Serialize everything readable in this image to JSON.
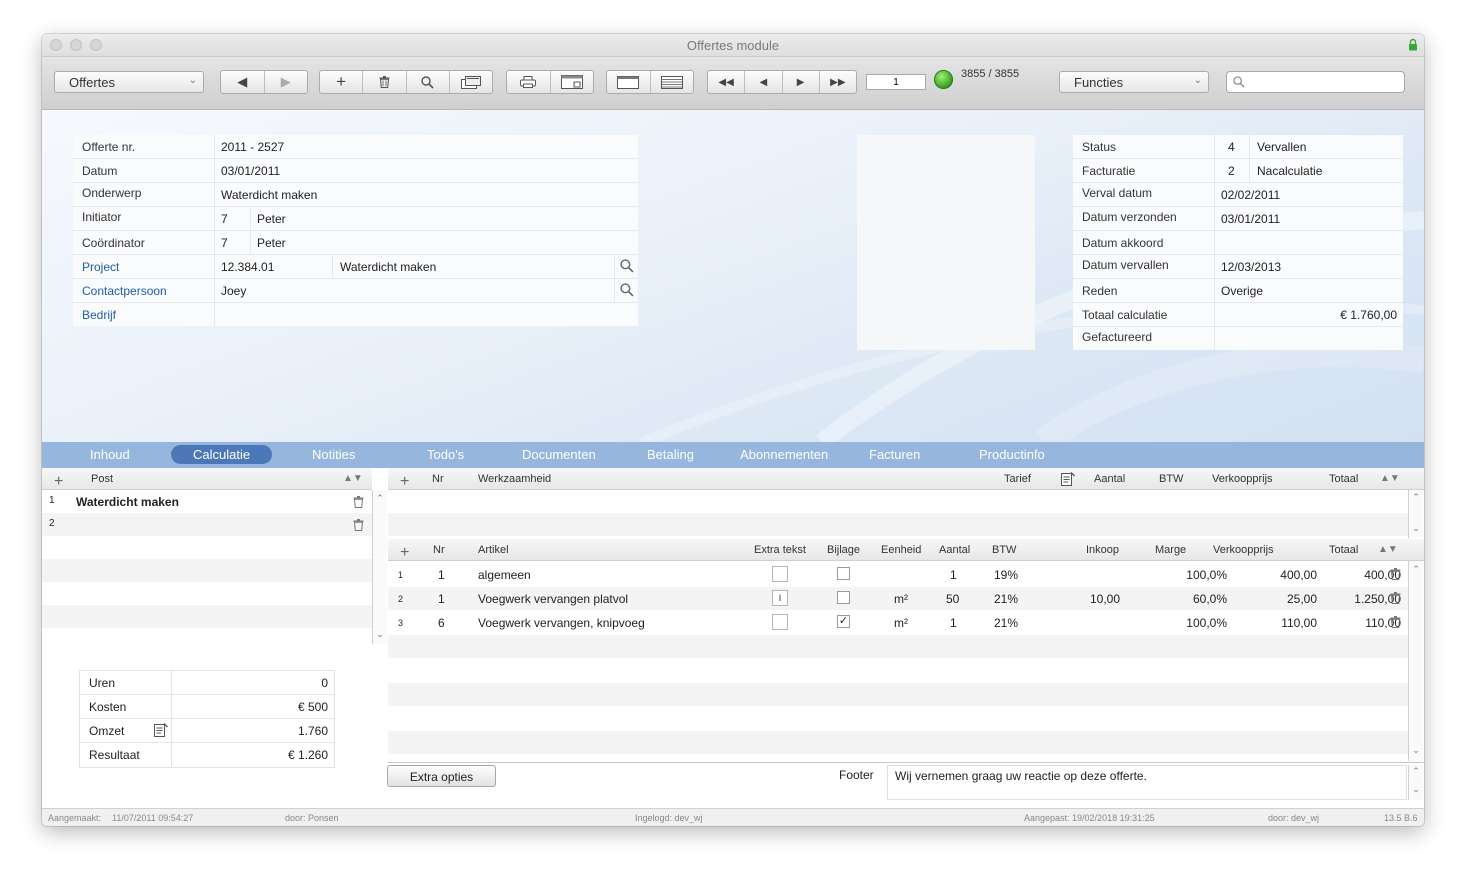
{
  "window": {
    "title": "Offertes module"
  },
  "toolbar": {
    "module_select": "Offertes",
    "record_input": "1",
    "record_count": "3855 / 3855",
    "functions_select": "Functies",
    "search_placeholder": ""
  },
  "form": {
    "offerte_nr": {
      "label": "Offerte nr.",
      "value": "2011 - 2527"
    },
    "datum": {
      "label": "Datum",
      "value": "03/01/2011"
    },
    "onderwerp": {
      "label": "Onderwerp",
      "value": "Waterdicht maken"
    },
    "initiator": {
      "label": "Initiator",
      "id": "7",
      "name": "Peter"
    },
    "coordinator": {
      "label": "Coördinator",
      "id": "7",
      "name": "Peter"
    },
    "project": {
      "label": "Project",
      "code": "12.384.01",
      "name": "Waterdicht maken"
    },
    "contactpersoon": {
      "label": "Contactpersoon",
      "value": "Joey"
    },
    "bedrijf": {
      "label": "Bedrijf",
      "value": ""
    }
  },
  "status_panel": {
    "status": {
      "label": "Status",
      "id": "4",
      "value": "Vervallen"
    },
    "facturatie": {
      "label": "Facturatie",
      "id": "2",
      "value": "Nacalculatie"
    },
    "verval_datum": {
      "label": "Verval datum",
      "value": "02/02/2011"
    },
    "datum_verzonden": {
      "label": "Datum verzonden",
      "value": "03/01/2011"
    },
    "datum_akkoord": {
      "label": "Datum akkoord",
      "value": ""
    },
    "datum_vervallen": {
      "label": "Datum vervallen",
      "value": "12/03/2013"
    },
    "reden": {
      "label": "Reden",
      "value": "Overige"
    },
    "totaal_calculatie": {
      "label": "Totaal calculatie",
      "value": "€ 1.760,00"
    },
    "gefactureerd": {
      "label": "Gefactureerd",
      "value": ""
    }
  },
  "tabs": [
    "Inhoud",
    "Calculatie",
    "Notities",
    "Todo's",
    "Documenten",
    "Betaling",
    "Abonnementen",
    "Facturen",
    "Productinfo"
  ],
  "posts": {
    "header": "Post",
    "rows": [
      {
        "nr": "1",
        "name": "Waterdicht maken"
      },
      {
        "nr": "2",
        "name": ""
      }
    ]
  },
  "werk": {
    "headers": {
      "nr": "Nr",
      "werkzaamheid": "Werkzaamheid",
      "tarief": "Tarief",
      "aantal": "Aantal",
      "btw": "BTW",
      "verkoopprijs": "Verkoopprijs",
      "totaal": "Totaal"
    }
  },
  "artikelen": {
    "headers": {
      "nr": "Nr",
      "artikel": "Artikel",
      "extra_tekst": "Extra tekst",
      "bijlage": "Bijlage",
      "eenheid": "Eenheid",
      "aantal": "Aantal",
      "btw": "BTW",
      "inkoop": "Inkoop",
      "marge": "Marge",
      "verkoopprijs": "Verkoopprijs",
      "totaal": "Totaal"
    },
    "rows": [
      {
        "idx": "1",
        "nr": "1",
        "artikel": "algemeen",
        "extra_tekst": "",
        "bijlage": "",
        "eenheid": "",
        "aantal": "1",
        "btw": "19%",
        "inkoop": "",
        "marge": "100,0%",
        "verkoopprijs": "400,00",
        "totaal": "400,00"
      },
      {
        "idx": "2",
        "nr": "1",
        "artikel": "Voegwerk vervangen platvol",
        "extra_tekst": "I",
        "bijlage": "",
        "eenheid": "m²",
        "aantal": "50",
        "btw": "21%",
        "inkoop": "10,00",
        "marge": "60,0%",
        "verkoopprijs": "25,00",
        "totaal": "1.250,00"
      },
      {
        "idx": "3",
        "nr": "6",
        "artikel": "Voegwerk vervangen, knipvoeg",
        "extra_tekst": "",
        "bijlage": "✓",
        "eenheid": "m²",
        "aantal": "1",
        "btw": "21%",
        "inkoop": "",
        "marge": "100,0%",
        "verkoopprijs": "110,00",
        "totaal": "110,00"
      }
    ]
  },
  "summary": {
    "uren": {
      "label": "Uren",
      "value": "0"
    },
    "kosten": {
      "label": "Kosten",
      "value": "€ 500"
    },
    "omzet": {
      "label": "Omzet",
      "value": "1.760"
    },
    "resultaat": {
      "label": "Resultaat",
      "value": "€ 1.260"
    }
  },
  "extra_opties_label": "Extra opties",
  "footer": {
    "label": "Footer",
    "value": "Wij vernemen graag uw reactie op deze offerte."
  },
  "statusbar": {
    "aangemaakt_label": "Aangemaakt:",
    "aangemaakt_value": "11/07/2011 09:54:27",
    "door1": "door:  Ponsen",
    "ingelogd": "Ingelogd:  dev_wj",
    "aangepast": "Aangepast:  19/02/2018 19:31:25",
    "door2": "door:  dev_wj",
    "version": "13.5 B.6"
  }
}
